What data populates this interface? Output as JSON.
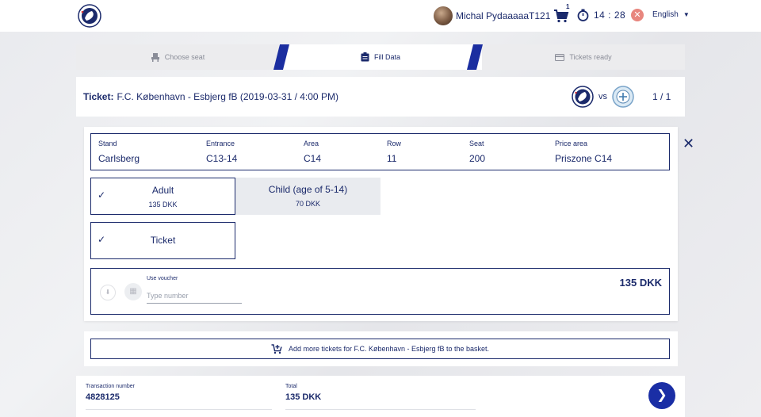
{
  "header": {
    "user_name": "Michal PydaaaaaT121",
    "cart_count": "1",
    "timer": "14 : 28",
    "language": "English"
  },
  "stepper": {
    "steps": [
      {
        "label": "Choose seat",
        "icon": "seat-icon",
        "active": false
      },
      {
        "label": "Fill Data",
        "icon": "clipboard-icon",
        "active": true
      },
      {
        "label": "Tickets ready",
        "icon": "card-icon",
        "active": false
      }
    ]
  },
  "ticket": {
    "prefix": "Ticket:",
    "match": "F.C. København - Esbjerg fB (2019-03-31 / 4:00 PM)",
    "vs": "vs",
    "counter": "1 / 1"
  },
  "seat": {
    "stand_label": "Stand",
    "stand": "Carlsberg",
    "entrance_label": "Entrance",
    "entrance": "C13-14",
    "area_label": "Area",
    "area": "C14",
    "row_label": "Row",
    "row": "11",
    "seat_label": "Seat",
    "seat": "200",
    "price_area_label": "Price area",
    "price_area": "Priszone C14"
  },
  "ticket_types": [
    {
      "title": "Adult",
      "price": "135 DKK",
      "selected": true
    },
    {
      "title": "Child (age of 5-14)",
      "price": "70 DKK",
      "selected": false
    }
  ],
  "product": {
    "title": "Ticket",
    "selected": true
  },
  "voucher": {
    "label": "Use voucher",
    "placeholder": "Type number",
    "price": "135 DKK"
  },
  "add_more": {
    "label": "Add more tickets for F.C. København - Esbjerg fB to the basket."
  },
  "summary": {
    "transaction_label": "Transaction number",
    "transaction_value": "4828125",
    "total_label": "Total",
    "total_value": "135 DKK"
  },
  "colors": {
    "navy": "#1b2a6b",
    "accent_blue": "#1a2ea5",
    "close_red": "#e8867e"
  }
}
